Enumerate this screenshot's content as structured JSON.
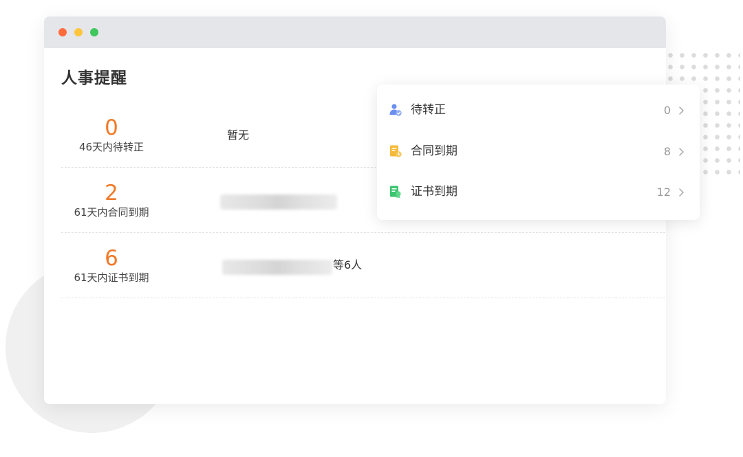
{
  "page": {
    "title": "人事提醒"
  },
  "reminders": [
    {
      "count": "0",
      "label": "46天内待转正",
      "detail": "暂无",
      "detail_suffix": ""
    },
    {
      "count": "2",
      "label": "61天内合同到期",
      "detail": "",
      "detail_suffix": ""
    },
    {
      "count": "6",
      "label": "61天内证书到期",
      "detail": "",
      "detail_suffix": "等6人"
    }
  ],
  "popup": {
    "items": [
      {
        "label": "待转正",
        "count": "0",
        "icon": "person-check-icon",
        "color": "#6b8ff0"
      },
      {
        "label": "合同到期",
        "count": "8",
        "icon": "contract-icon",
        "color": "#f5b93a"
      },
      {
        "label": "证书到期",
        "count": "12",
        "icon": "certificate-icon",
        "color": "#3cc46e"
      }
    ]
  },
  "colors": {
    "accent_orange": "#f07a28",
    "titlebar": "#e4e6ea",
    "traffic_red": "#ff6b3a",
    "traffic_yellow": "#ffc53d",
    "traffic_green": "#3ec75b"
  }
}
